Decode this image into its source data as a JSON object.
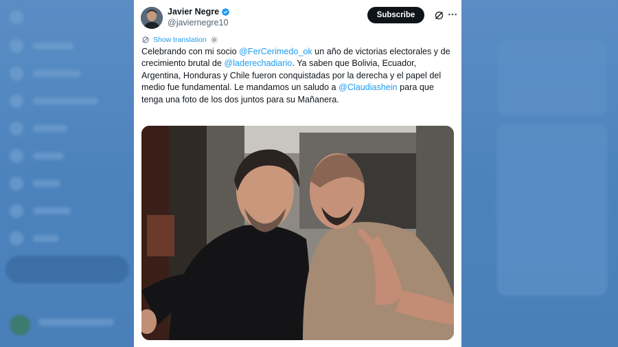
{
  "tweet": {
    "author_name": "Javier Negre",
    "author_handle": "@javiernegre10",
    "subscribe_label": "Subscribe",
    "translate_label": "Show translation",
    "text": {
      "p1": "Celebrando con mi socio ",
      "m1": "@FerCerimedo_ok",
      "p2": " un año de victorias electorales y de crecimiento brutal de ",
      "m2": "@laderechadiario",
      "p3": ". Ya saben que Bolivia, Ecuador, Argentina, Honduras y Chile fueron conquistadas por la derecha y el papel del medio fue fundamental. Le mandamos un saludo a ",
      "m3": "@Claudiashein",
      "p4": " para que tenga una foto de los dos juntos para su Mañanera."
    },
    "icons": {
      "verified": "verified-badge-icon",
      "grok": "grok-icon",
      "more": "more-options-icon",
      "translate": "translate-icon",
      "settings": "gear-icon"
    },
    "colors": {
      "link": "#1d9bf0",
      "text": "#0f1419",
      "secondary": "#536471",
      "subscribe_bg": "#0f1419"
    }
  }
}
